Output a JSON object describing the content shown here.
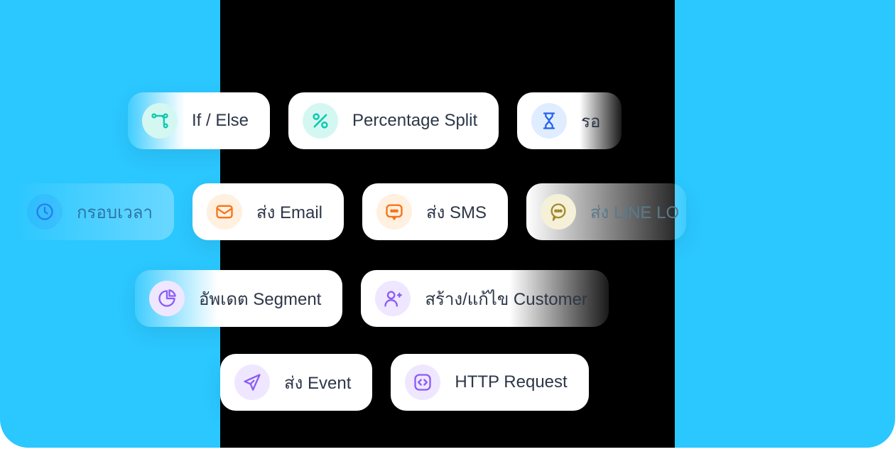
{
  "actions": {
    "ifelse": "If / Else",
    "percentage": "Percentage Split",
    "wait": "รอ",
    "timeframe": "กรอบเวลา",
    "email": "ส่ง Email",
    "sms": "ส่ง SMS",
    "line": "ส่ง LINE LO",
    "segment": "อัพเดต Segment",
    "customer": "สร้าง/แก้ไข Customer",
    "event": "ส่ง Event",
    "http": "HTTP Request"
  }
}
